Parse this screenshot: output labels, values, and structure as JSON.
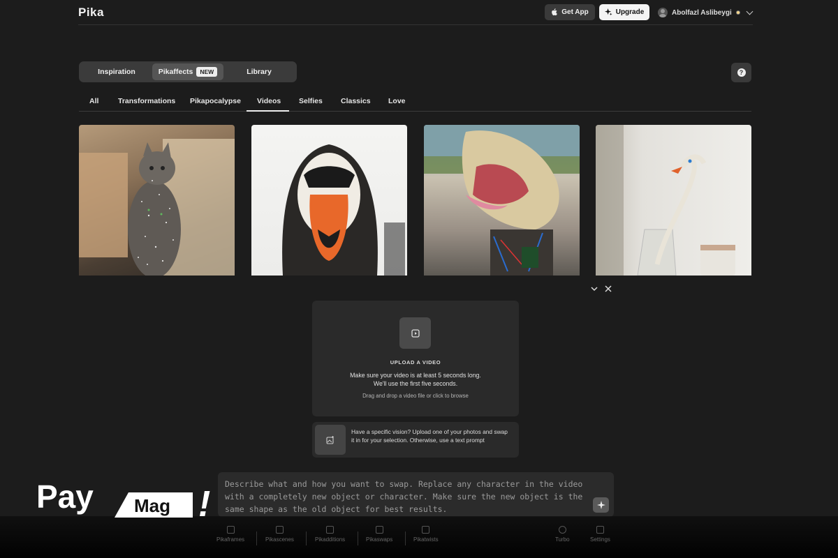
{
  "header": {
    "logo": "Pika",
    "get_app_label": "Get App",
    "upgrade_label": "Upgrade",
    "user_name": "Abolfazl Aslibeygi"
  },
  "mode_tabs": [
    {
      "label": "Inspiration"
    },
    {
      "label": "Pikaffects",
      "badge": "NEW",
      "active": true
    },
    {
      "label": "Library"
    }
  ],
  "help_label": "?",
  "category_tabs": [
    {
      "label": "All"
    },
    {
      "label": "Transformations"
    },
    {
      "label": "Pikapocalypse"
    },
    {
      "label": "Videos",
      "active": true
    },
    {
      "label": "Selfies"
    },
    {
      "label": "Classics"
    },
    {
      "label": "Love"
    }
  ],
  "gallery": [
    {
      "icon": "sparkling-cat-thumbnail"
    },
    {
      "icon": "duck-face-person-thumbnail"
    },
    {
      "icon": "robot-dog-thumbnail"
    },
    {
      "icon": "swan-toothbrush-thumbnail"
    }
  ],
  "upload": {
    "title": "UPLOAD A VIDEO",
    "line1": "Make sure your video is at least 5 seconds long.",
    "line2": "We'll use the first five seconds.",
    "hint": "Drag and drop a video file or click to browse"
  },
  "vision": {
    "text": "Have a specific vision? Upload one of your photos and swap it in for your selection. Otherwise, use a text prompt"
  },
  "prompt": {
    "placeholder": "Describe what and how you want to swap. Replace any character in the video with a completely new object or character. Make sure the new object is the same shape as the old object for best results."
  },
  "toolbar": {
    "items": [
      {
        "label": "Pikaframes"
      },
      {
        "label": "Pikascenes"
      },
      {
        "label": "Pikadditions"
      },
      {
        "label": "Pikaswaps"
      },
      {
        "label": "Pikatwists"
      }
    ],
    "right_items": [
      {
        "label": "Turbo"
      },
      {
        "label": "Settings"
      }
    ]
  },
  "watermark": {
    "left_text": "Pay",
    "box_text": "Mag",
    "mark": "!"
  },
  "colors": {
    "background": "#1c1c1c",
    "panel": "#2a2a2a",
    "accent_light": "#f4f4f4"
  }
}
